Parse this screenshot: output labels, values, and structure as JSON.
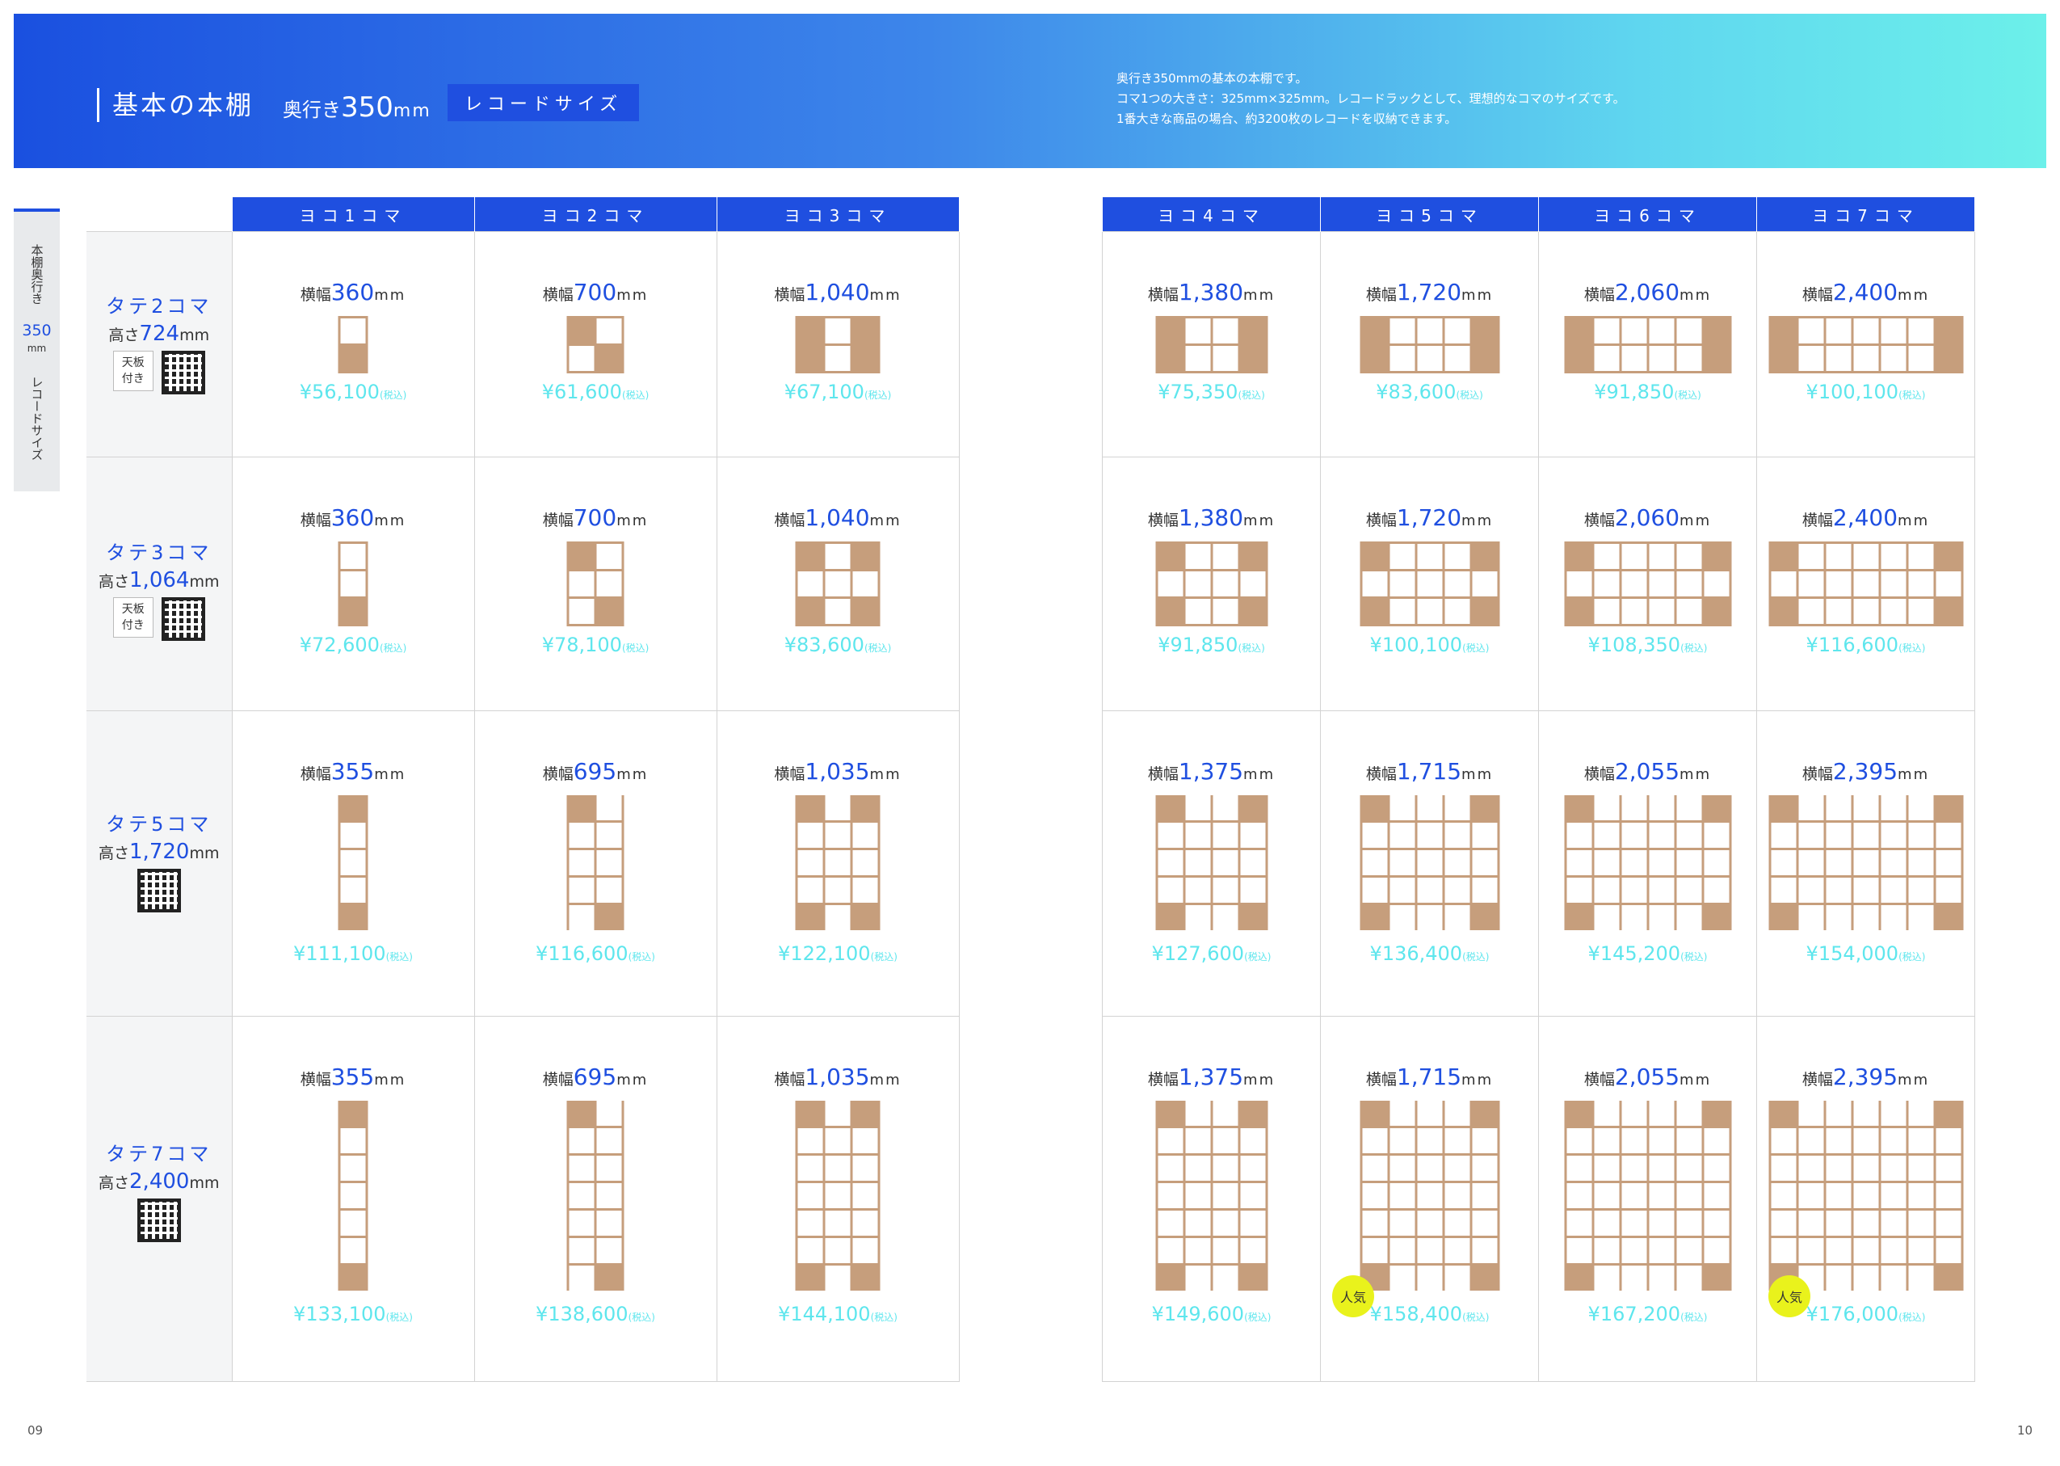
{
  "header": {
    "title": "基本の本棚",
    "depth_prefix": "奥行き",
    "depth_value": "350",
    "depth_unit": "mm",
    "badge": "レコードサイズ",
    "desc": [
      "奥行き350mmの基本の本棚です。",
      "コマ1つの大きさ：325mm×325mm。レコードラックとして、理想的なコマのサイズです。",
      "1番大きな商品の場合、約3200枚のレコードを収納できます。"
    ]
  },
  "side_tab": {
    "line1": "本棚奥行き",
    "value": "350",
    "unit": "mm",
    "line2": "レコードサイズ"
  },
  "labels": {
    "width_prefix": "横幅",
    "height_prefix": "高さ",
    "unit": "mm",
    "tax": "(税込)",
    "tenban_1": "天板",
    "tenban_2": "付き",
    "popular": "人気"
  },
  "columns_left": [
    "ヨコ1コマ",
    "ヨコ2コマ",
    "ヨコ3コマ"
  ],
  "columns_right": [
    "ヨコ4コマ",
    "ヨコ5コマ",
    "ヨコ6コマ",
    "ヨコ7コマ"
  ],
  "rows": [
    {
      "name": "タテ2コマ",
      "height": "724",
      "tenban": true,
      "rows": 2
    },
    {
      "name": "タテ3コマ",
      "height": "1,064",
      "tenban": true,
      "rows": 3
    },
    {
      "name": "タテ5コマ",
      "height": "1,720",
      "tenban": false,
      "rows": 5
    },
    {
      "name": "タテ7コマ",
      "height": "2,400",
      "tenban": false,
      "rows": 7
    }
  ],
  "cells": [
    [
      {
        "w": "360",
        "p": "¥56,100"
      },
      {
        "w": "700",
        "p": "¥61,600"
      },
      {
        "w": "1,040",
        "p": "¥67,100"
      },
      {
        "w": "1,380",
        "p": "¥75,350"
      },
      {
        "w": "1,720",
        "p": "¥83,600"
      },
      {
        "w": "2,060",
        "p": "¥91,850"
      },
      {
        "w": "2,400",
        "p": "¥100,100"
      }
    ],
    [
      {
        "w": "360",
        "p": "¥72,600"
      },
      {
        "w": "700",
        "p": "¥78,100"
      },
      {
        "w": "1,040",
        "p": "¥83,600"
      },
      {
        "w": "1,380",
        "p": "¥91,850"
      },
      {
        "w": "1,720",
        "p": "¥100,100"
      },
      {
        "w": "2,060",
        "p": "¥108,350"
      },
      {
        "w": "2,400",
        "p": "¥116,600"
      }
    ],
    [
      {
        "w": "355",
        "p": "¥111,100"
      },
      {
        "w": "695",
        "p": "¥116,600"
      },
      {
        "w": "1,035",
        "p": "¥122,100"
      },
      {
        "w": "1,375",
        "p": "¥127,600"
      },
      {
        "w": "1,715",
        "p": "¥136,400"
      },
      {
        "w": "2,055",
        "p": "¥145,200"
      },
      {
        "w": "2,395",
        "p": "¥154,000"
      }
    ],
    [
      {
        "w": "355",
        "p": "¥133,100"
      },
      {
        "w": "695",
        "p": "¥138,600"
      },
      {
        "w": "1,035",
        "p": "¥144,100"
      },
      {
        "w": "1,375",
        "p": "¥149,600"
      },
      {
        "w": "1,715",
        "p": "¥158,400",
        "popular": true
      },
      {
        "w": "2,055",
        "p": "¥167,200"
      },
      {
        "w": "2,395",
        "p": "¥176,000",
        "popular": true
      }
    ]
  ],
  "page_left": "09",
  "page_right": "10"
}
